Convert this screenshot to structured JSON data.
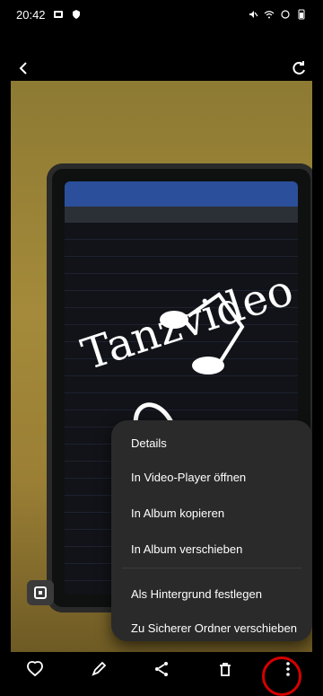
{
  "status": {
    "time": "20:42"
  },
  "top": {
    "back_icon": "chevron-left-icon",
    "share_icon": "rotate-icon"
  },
  "photo": {
    "description_text": "Tanzvideo"
  },
  "menu": {
    "items": [
      "Details",
      "In Video-Player öffnen",
      "In Album kopieren",
      "In Album verschieben",
      "Als Hintergrund festlegen",
      "Zu Sicherer Ordner verschieben"
    ]
  },
  "bottom": {
    "favorite_icon": "heart-icon",
    "edit_icon": "pencil-icon",
    "share_icon": "share-icon",
    "delete_icon": "trash-icon",
    "more_icon": "more-vert-icon"
  }
}
